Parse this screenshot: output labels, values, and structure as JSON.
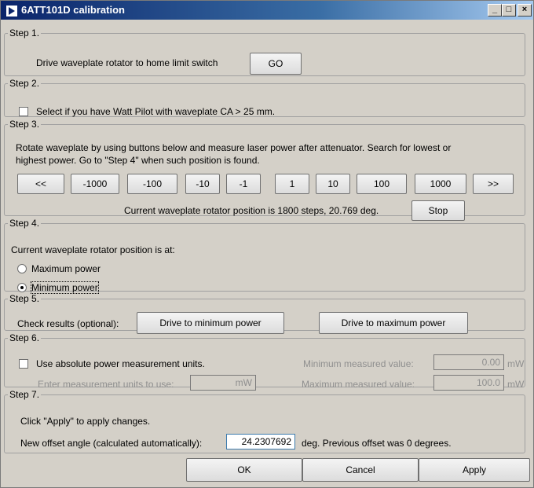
{
  "window": {
    "title": "6ATT101D calibration",
    "minimize": "_",
    "maximize": "□",
    "close": "×"
  },
  "step1": {
    "legend": "Step 1.",
    "text": "Drive waveplate rotator to home limit switch",
    "go_label": "GO"
  },
  "step2": {
    "legend": "Step 2.",
    "checkbox_label": "Select if you have Watt Pilot with waveplate CA > 25 mm.",
    "checked": false
  },
  "step3": {
    "legend": "Step 3.",
    "instructions_line1": "Rotate waveplate by using buttons below and measure laser power after attenuator. Search for lowest or",
    "instructions_line2": "highest power. Go to \"Step 4\" when such position is found.",
    "buttons": [
      "<<",
      "-1000",
      "-100",
      "-10",
      "-1",
      "1",
      "10",
      "100",
      "1000",
      ">>"
    ],
    "position_text": "Current waveplate rotator position is 1800 steps, 20.769 deg.",
    "stop_label": "Stop"
  },
  "step4": {
    "legend": "Step 4.",
    "prompt": "Current waveplate rotator position is at:",
    "option_max": "Maximum power",
    "option_min": "Minimum power",
    "selected": "Minimum power"
  },
  "step5": {
    "legend": "Step 5.",
    "label": "Check results (optional):",
    "drive_min_label": "Drive to minimum power",
    "drive_max_label": "Drive to maximum power"
  },
  "step6": {
    "legend": "Step 6.",
    "checkbox_label": "Use absolute power measurement units.",
    "checked": false,
    "units_label": "Enter measurement units to use:",
    "units_value": "mW",
    "min_label": "Minimum measured value:",
    "min_value": "0.00",
    "min_unit": "mW",
    "max_label": "Maximum measured value:",
    "max_value": "100.0",
    "max_unit": "mW"
  },
  "step7": {
    "legend": "Step 7.",
    "hint": "Click \"Apply\" to apply changes.",
    "offset_label": "New offset angle (calculated automatically):",
    "offset_value": "24.2307692",
    "suffix": "deg.  Previous offset was 0 degrees."
  },
  "footer": {
    "ok_label": "OK",
    "cancel_label": "Cancel",
    "apply_label": "Apply"
  }
}
